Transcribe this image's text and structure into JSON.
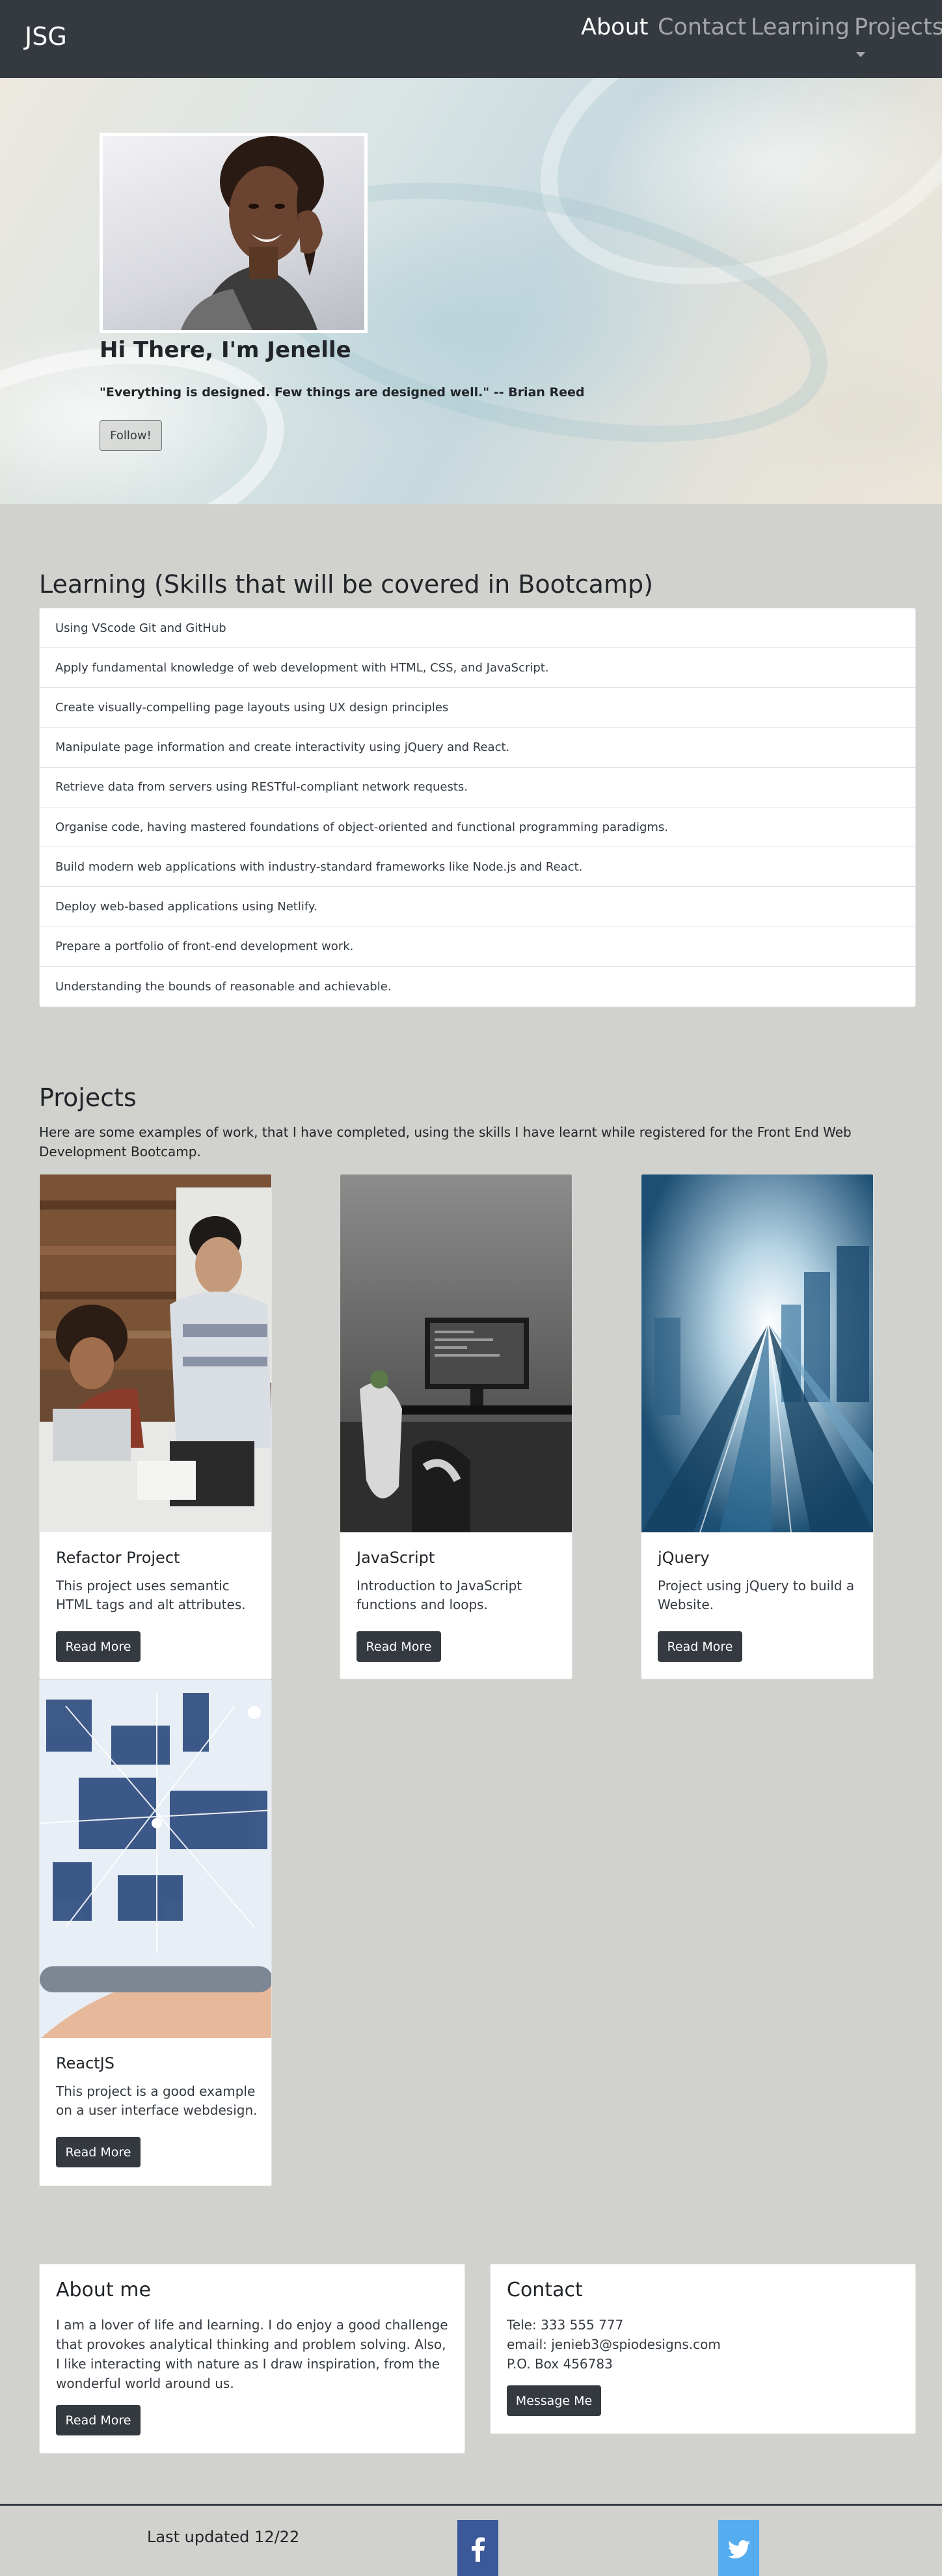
{
  "navbar": {
    "brand": "JSG",
    "links": [
      {
        "label": "About",
        "active": true
      },
      {
        "label": "Contact",
        "active": false
      },
      {
        "label": "Learning",
        "active": false
      },
      {
        "label": "Projects",
        "active": false
      }
    ],
    "colors": {
      "background": "#343a40",
      "active": "#ffffff",
      "inactive": "rgba(255,255,255,0.55)"
    }
  },
  "hero": {
    "title": "Hi There, I'm Jenelle",
    "quote": "\"Everything is designed. Few things are designed well.\" -- Brian Reed",
    "follow_label": "Follow!"
  },
  "learning": {
    "title": "Learning (Skills that will be covered in Bootcamp)",
    "items": [
      "Using VScode Git and GitHub",
      "Apply fundamental knowledge of web development with HTML, CSS, and JavaScript.",
      "Create visually-compelling page layouts using UX design principles",
      "Manipulate page information and create interactivity using jQuery and React.",
      "Retrieve data from servers using RESTful-compliant network requests.",
      "Organise code, having mastered foundations of object-oriented and functional programming paradigms.",
      "Build modern web applications with industry-standard frameworks like Node.js and React.",
      "Deploy web-based applications using Netlify.",
      "Prepare a portfolio of front-end development work.",
      "Understanding the bounds of reasonable and achievable."
    ]
  },
  "projects": {
    "title": "Projects",
    "description": "Here are some examples of work, that I have completed, using the skills I have learnt while registered for the Front End Web Development Bootcamp.",
    "cards": [
      {
        "title": "Refactor Project",
        "text": "This project uses semantic HTML tags and alt attributes.",
        "button": "Read More"
      },
      {
        "title": "JavaScript",
        "text": "Introduction to JavaScript functions and loops.",
        "button": "Read More"
      },
      {
        "title": "jQuery",
        "text": "Project using jQuery to build a Website.",
        "button": "Read More"
      },
      {
        "title": "ReactJS",
        "text": "This project is a good example on a user interface webdesign.",
        "button": "Read More"
      }
    ]
  },
  "about": {
    "title": "About me",
    "text": "I am a lover of life and learning. I do enjoy a good challenge that provokes analytical thinking and problem solving. Also, I like interacting with nature as I draw inspiration, from the wonderful world around us.",
    "button": "Read More"
  },
  "contact": {
    "title": "Contact",
    "lines": [
      "Tele: 333 555 777",
      "email: jenieb3@spiodesigns.com",
      "P.O. Box 456783"
    ],
    "button": "Message Me"
  },
  "footer": {
    "text": "Last updated 12/22",
    "icons": [
      "facebook-icon",
      "twitter-icon"
    ],
    "colors": {
      "facebook": "#3b5998",
      "twitter": "#55acee"
    }
  },
  "theme": {
    "page_background": "#d1d1cd",
    "button": "#343a40"
  }
}
